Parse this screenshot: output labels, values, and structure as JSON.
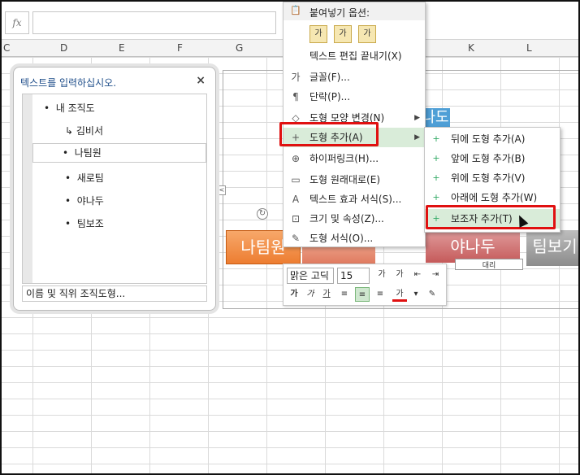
{
  "formula_bar": {
    "fx_label": "fx"
  },
  "columns": [
    {
      "label": "C"
    },
    {
      "label": "D"
    },
    {
      "label": "E"
    },
    {
      "label": "F"
    },
    {
      "label": "G"
    },
    {
      "label": "K"
    },
    {
      "label": "L"
    }
  ],
  "text_pane": {
    "title": "텍스트를 입력하십시오.",
    "close": "×",
    "items": [
      {
        "text": "내 조직도",
        "bullet": "•"
      },
      {
        "text": "김비서",
        "bullet": "↳"
      },
      {
        "text": "나팀원",
        "bullet": "•"
      },
      {
        "text": "새로팀",
        "bullet": "•"
      },
      {
        "text": "야나두",
        "bullet": "•"
      },
      {
        "text": "팀보조",
        "bullet": "•"
      }
    ],
    "footer": "이름 및 직위 조직도형..."
  },
  "shapes": {
    "natim": "나팀원",
    "yana": "야나두",
    "tim": "팀보기",
    "top": "나도",
    "yana_sub": "대리"
  },
  "context_menu": {
    "paste_header": "붙여넣기 옵션:",
    "paste_icon": "가",
    "items": [
      {
        "icon": "",
        "label": "텍스트 편집 끝내기(X)",
        "arrow": ""
      },
      {
        "icon": "가",
        "label": "글꼴(F)...",
        "arrow": ""
      },
      {
        "icon": "¶",
        "label": "단락(P)...",
        "arrow": ""
      },
      {
        "icon": "◇",
        "label": "도형 모양 변경(N)",
        "arrow": "▶"
      },
      {
        "icon": "+",
        "label": "도형 추가(A)",
        "arrow": "▶"
      },
      {
        "icon": "⊕",
        "label": "하이퍼링크(H)...",
        "arrow": ""
      },
      {
        "icon": "▭",
        "label": "도형 원래대로(E)",
        "arrow": ""
      },
      {
        "icon": "A",
        "label": "텍스트 효과 서식(S)...",
        "arrow": ""
      },
      {
        "icon": "⊡",
        "label": "크기 및 속성(Z)...",
        "arrow": ""
      },
      {
        "icon": "✎",
        "label": "도형 서식(O)...",
        "arrow": ""
      }
    ]
  },
  "submenu": {
    "items": [
      {
        "icon": "+",
        "label": "뒤에 도형 추가(A)"
      },
      {
        "icon": "+",
        "label": "앞에 도형 추가(B)"
      },
      {
        "icon": "+",
        "label": "위에 도형 추가(V)"
      },
      {
        "icon": "+",
        "label": "아래에 도형 추가(W)"
      },
      {
        "icon": "+",
        "label": "보조자 추가(T)"
      }
    ]
  },
  "mini_toolbar": {
    "font": "맑은 고딕",
    "size": "15",
    "grow": "가",
    "shrink": "가",
    "bold": "가",
    "italic": "가",
    "underline": "가",
    "font_color": "가"
  },
  "colors": {
    "accent_red": "#e01010",
    "highlight_green": "#d9ecd9",
    "orange": "#ed7d31"
  }
}
